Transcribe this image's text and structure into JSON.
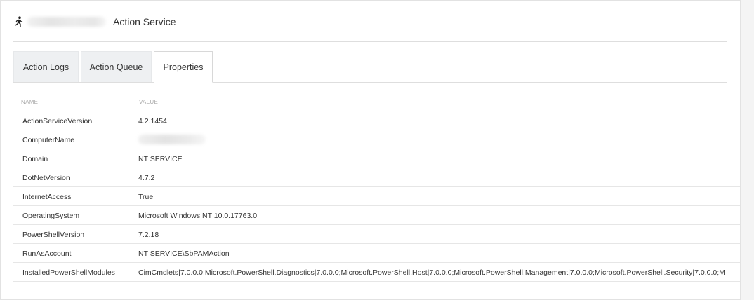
{
  "header": {
    "icon": "running-person-icon",
    "title": "Action Service"
  },
  "tabs": [
    {
      "label": "Action Logs",
      "active": false
    },
    {
      "label": "Action Queue",
      "active": false
    },
    {
      "label": "Properties",
      "active": true
    }
  ],
  "table": {
    "columns": [
      "NAME",
      "VALUE"
    ],
    "rows": [
      {
        "name": "ActionServiceVersion",
        "value": "4.2.1454"
      },
      {
        "name": "ComputerName",
        "value": ""
      },
      {
        "name": "Domain",
        "value": "NT SERVICE"
      },
      {
        "name": "DotNetVersion",
        "value": "4.7.2"
      },
      {
        "name": "InternetAccess",
        "value": "True"
      },
      {
        "name": "OperatingSystem",
        "value": "Microsoft Windows NT 10.0.17763.0"
      },
      {
        "name": "PowerShellVersion",
        "value": "7.2.18"
      },
      {
        "name": "RunAsAccount",
        "value": "NT SERVICE\\SbPAMAction"
      },
      {
        "name": "InstalledPowerShellModules",
        "value": "CimCmdlets|7.0.0.0;Microsoft.PowerShell.Diagnostics|7.0.0.0;Microsoft.PowerShell.Host|7.0.0.0;Microsoft.PowerShell.Management|7.0.0.0;Microsoft.PowerShell.Security|7.0.0.0;M"
      }
    ]
  },
  "colors": {
    "tab_inactive_bg": "#eef0f2",
    "border": "#dedede",
    "text": "#333333",
    "header_text": "#aaaaaa"
  }
}
